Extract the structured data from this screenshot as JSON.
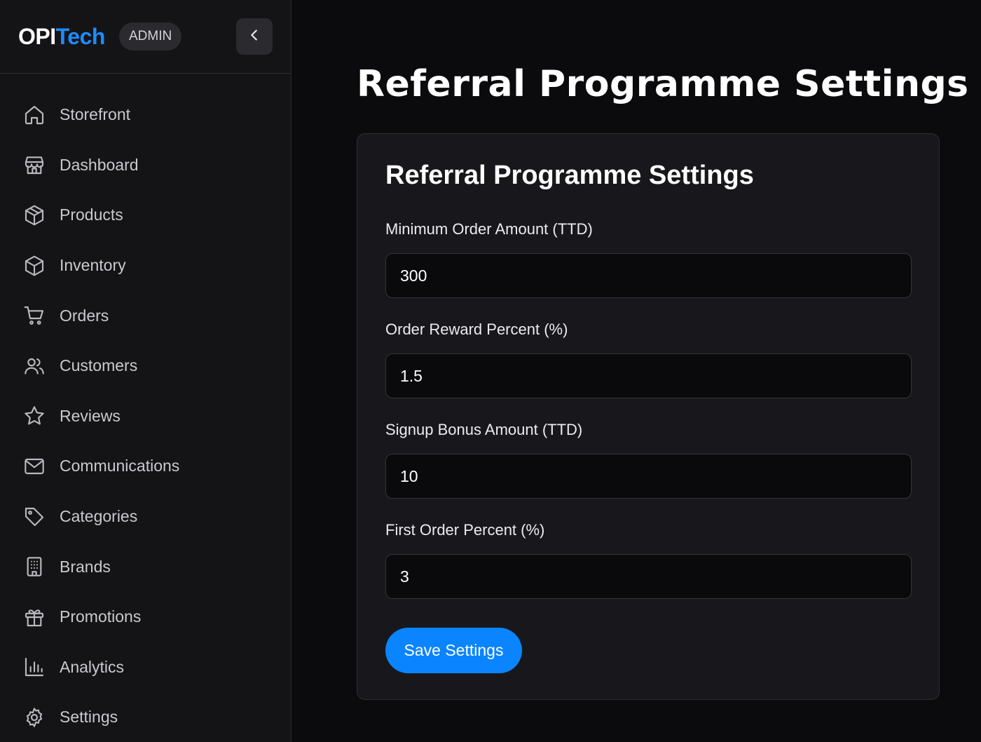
{
  "brand": {
    "name_part1": "OPI",
    "name_part2": "Tech",
    "badge": "ADMIN"
  },
  "sidebar": {
    "collapse_icon": "chevron-left-icon",
    "items": [
      {
        "label": "Storefront",
        "icon": "home-icon"
      },
      {
        "label": "Dashboard",
        "icon": "store-icon"
      },
      {
        "label": "Products",
        "icon": "package-icon"
      },
      {
        "label": "Inventory",
        "icon": "box-icon"
      },
      {
        "label": "Orders",
        "icon": "cart-icon"
      },
      {
        "label": "Customers",
        "icon": "users-icon"
      },
      {
        "label": "Reviews",
        "icon": "star-icon"
      },
      {
        "label": "Communications",
        "icon": "mail-icon"
      },
      {
        "label": "Categories",
        "icon": "tag-icon"
      },
      {
        "label": "Brands",
        "icon": "building-icon"
      },
      {
        "label": "Promotions",
        "icon": "gift-icon"
      },
      {
        "label": "Analytics",
        "icon": "bar-chart-icon"
      },
      {
        "label": "Settings",
        "icon": "gear-icon"
      }
    ]
  },
  "main": {
    "page_title": "Referral Programme Settings",
    "card": {
      "title": "Referral Programme Settings",
      "fields": [
        {
          "label": "Minimum Order Amount (TTD)",
          "value": "300"
        },
        {
          "label": "Order Reward Percent (%)",
          "value": "1.5"
        },
        {
          "label": "Signup Bonus Amount (TTD)",
          "value": "10"
        },
        {
          "label": "First Order Percent (%)",
          "value": "3"
        }
      ],
      "save_label": "Save Settings"
    }
  },
  "colors": {
    "accent": "#0a84ff",
    "brand_blue": "#1f8bff",
    "background": "#0b0b0d",
    "sidebar": "#141417",
    "card": "#18181c"
  }
}
